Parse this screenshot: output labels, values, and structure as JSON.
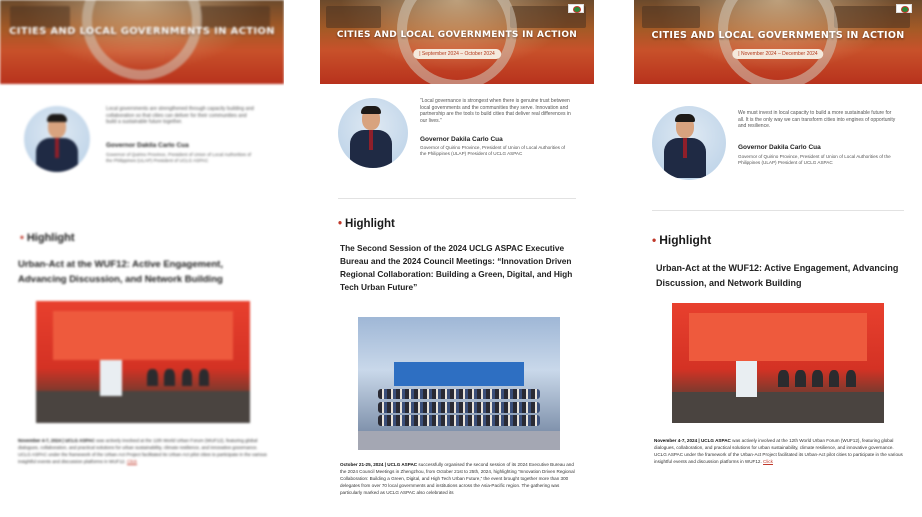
{
  "banner": {
    "title": "CITIES AND LOCAL GOVERNMENTS IN ACTION",
    "title_blurred": "CITIES AND LOCAL GOVERNMENTS IN ACTION",
    "date_p2": "| September 2024 – October 2024",
    "date_p3": "| November 2024 – December 2024"
  },
  "governor": {
    "name": "Governor Dakila Carlo Cua",
    "role": "Governor of Quirino Province, President of Union of Local Authorities of the Philippines (ULAP) President of UCLG ASPAC",
    "quote_p1": "Local governments are strengthened through capacity building and collaboration so that cities can deliver for their communities and build a sustainable future together.",
    "quote_p2": "“Local governance is strongest when there is genuine trust between local governments and the communities they serve. Innovation and partnership are the tools to build cities that deliver real differences in our lives.”",
    "quote_p3": "We must invest in local capacity to build a more sustainable future for all. It is the only way we can transform cities into engines of opportunity and resilience."
  },
  "highlight": {
    "label": "Highlight"
  },
  "articles": {
    "p1_title": "Urban-Act at the WUF12: Active Engagement, Advancing Discussion, and Network Building",
    "p2_title": "The Second Session of the 2024 UCLG ASPAC Executive Bureau and the 2024 Council Meetings: “Innovation Driven Regional Collaboration: Building a Green, Digital, and High Tech Urban Future”",
    "p3_title": "Urban-Act at the WUF12: Active Engagement, Advancing Discussion, and Network Building",
    "p1_body_lead": "November 4-7, 2024 | UCLG ASPAC",
    "p1_body": "was actively involved at the 12th World Urban Forum (WUF12), featuring global dialogues, collaboration, and practical solutions for urban sustainability, climate resilience, and innovative governance. UCLG ASPAC under the framework of the Urban-Act Project facilitated its Urban-Act pilot cities to participate in the various insightful events and discussion platforms in WUF12.",
    "p1_link": "Click",
    "p2_body_lead": "October 21-25, 2024 | UCLG ASPAC",
    "p2_body": "successfully organised the second session of its 2024 Executive Bureau and the 2024 Council Meetings in Zhengzhou, from October 21st to 25th, 2024, highlighting “Innovation Driven Regional Collaboration: Building a Green, Digital, and High Tech Urban Future,” the event brought together more than 300 delegates from over 70 local governments and institutions across the Asia-Pacific region. The gathering was particularly marked as UCLG ASPAC also celebrated its",
    "p3_body_lead": "November 4-7, 2024 | UCLG ASPAC",
    "p3_body": "was actively involved at the 12th World Urban Forum (WUF12), featuring global dialogues, collaboration, and practical solutions for urban sustainability, climate resilience, and innovative governance. UCLG ASPAC under the framework of the Urban-Act Project facilitated its Urban-Act pilot cities to participate in the various insightful events and discussion platforms in WUF12.",
    "p3_link": "Click"
  },
  "colors": {
    "accent": "#c0392b",
    "banner_red": "#b8321d",
    "text": "#222222"
  }
}
